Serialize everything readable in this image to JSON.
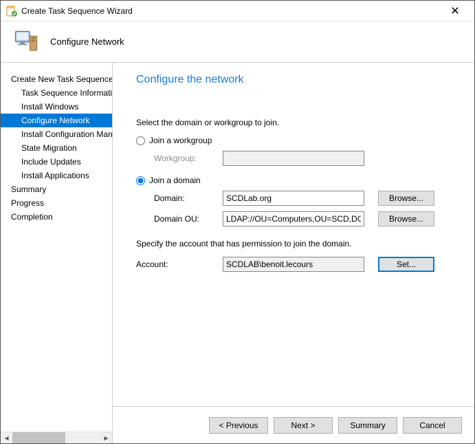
{
  "window": {
    "title": "Create Task Sequence Wizard",
    "header": "Configure Network"
  },
  "sidebar": {
    "items": [
      {
        "label": "Create New Task Sequence",
        "child": false,
        "selected": false
      },
      {
        "label": "Task Sequence Information",
        "child": true,
        "selected": false
      },
      {
        "label": "Install Windows",
        "child": true,
        "selected": false
      },
      {
        "label": "Configure Network",
        "child": true,
        "selected": true
      },
      {
        "label": "Install Configuration Manager Client",
        "child": true,
        "selected": false
      },
      {
        "label": "State Migration",
        "child": true,
        "selected": false
      },
      {
        "label": "Include Updates",
        "child": true,
        "selected": false
      },
      {
        "label": "Install Applications",
        "child": true,
        "selected": false
      },
      {
        "label": "Summary",
        "child": false,
        "selected": false
      },
      {
        "label": "Progress",
        "child": false,
        "selected": false
      },
      {
        "label": "Completion",
        "child": false,
        "selected": false
      }
    ]
  },
  "content": {
    "heading": "Configure the network",
    "instruction1": "Select the domain or workgroup to join.",
    "radio_workgroup": "Join a workgroup",
    "workgroup_label": "Workgroup:",
    "workgroup_value": "",
    "radio_domain": "Join a domain",
    "domain_label": "Domain:",
    "domain_value": "SCDLab.org",
    "ou_label": "Domain OU:",
    "ou_value": "LDAP://OU=Computers,OU=SCD,DC=SCDLab,DC=org",
    "browse_label": "Browse...",
    "instruction2": "Specify the account that has permission to join the domain.",
    "account_label": "Account:",
    "account_value": "SCDLAB\\benoit.lecours",
    "set_label": "Set..."
  },
  "footer": {
    "previous": "< Previous",
    "next": "Next >",
    "summary": "Summary",
    "cancel": "Cancel"
  }
}
